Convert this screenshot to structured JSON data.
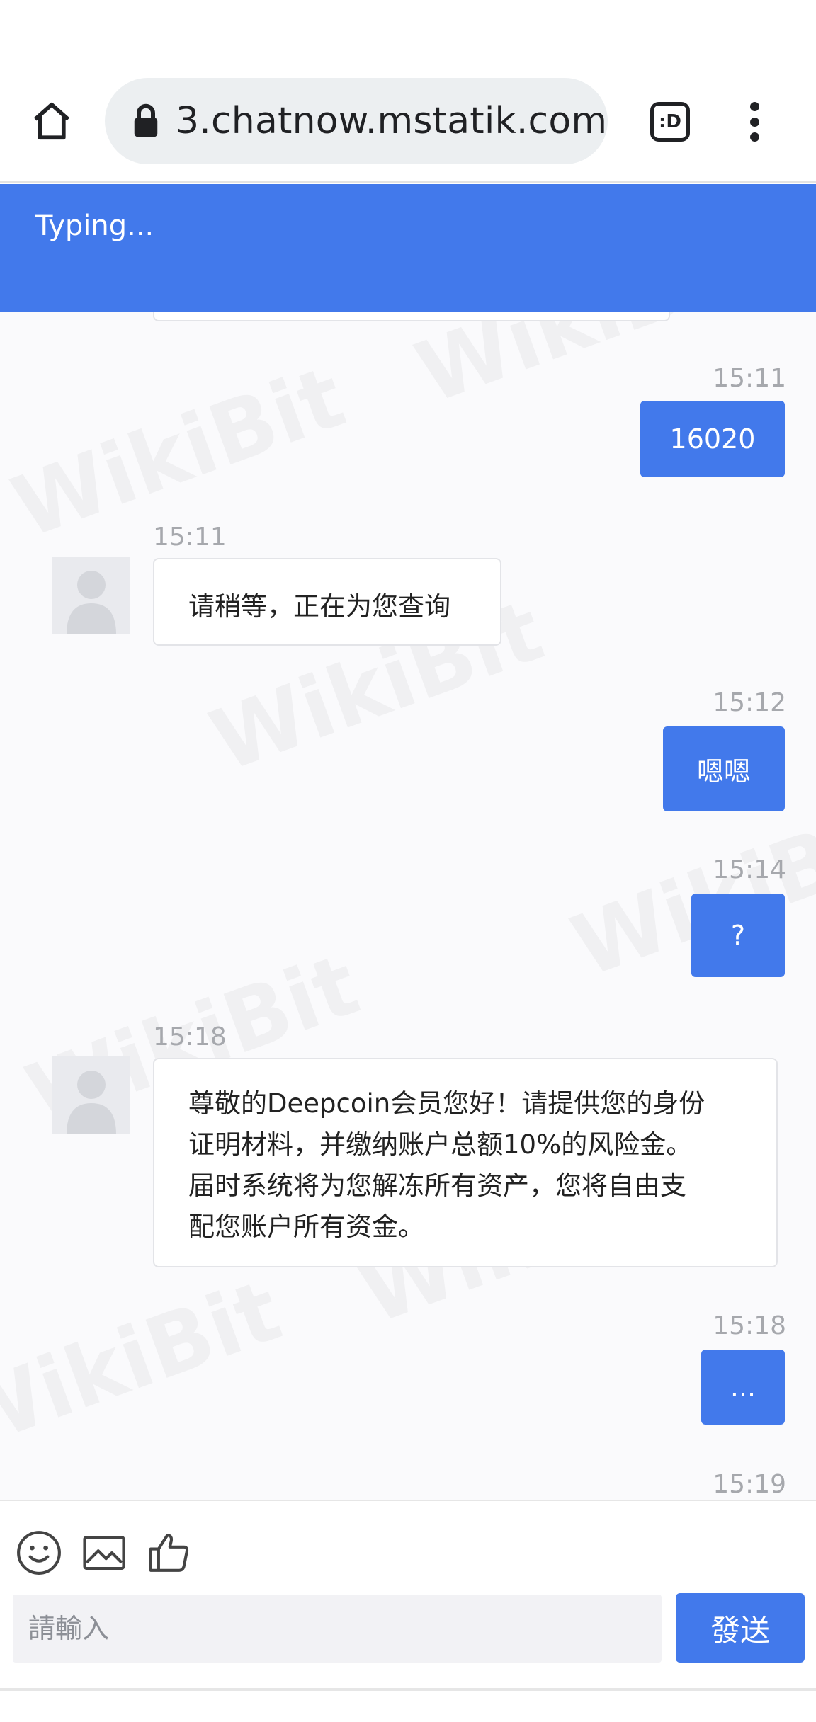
{
  "browser": {
    "url": "3.chatnow.mstatik.com",
    "tab_switcher_label": ":D"
  },
  "chat": {
    "status": "Typing...",
    "messages": [
      {
        "side": "out",
        "time": "15:11",
        "text": "16020"
      },
      {
        "side": "in",
        "time": "15:11",
        "text": "请稍等，正在为您查询"
      },
      {
        "side": "out",
        "time": "15:12",
        "text": "嗯嗯"
      },
      {
        "side": "out",
        "time": "15:14",
        "text": "?"
      },
      {
        "side": "in",
        "time": "15:18",
        "lines": [
          "尊敬的Deepcoin会员您好！请提供您的身份",
          "证明材料，并缴纳账户总额10%的风险金。",
          "届时系统将为您解冻所有资产，您将自由支",
          "配您账户所有资金。"
        ]
      },
      {
        "side": "out",
        "time": "15:18",
        "text": "..."
      },
      {
        "side": "out",
        "time": "15:19"
      }
    ]
  },
  "watermark_text": "WikiBit",
  "input": {
    "placeholder": "請輸入",
    "send_label": "發送",
    "tools": [
      "emoji-icon",
      "image-icon",
      "thumbs-up-icon"
    ]
  },
  "colors": {
    "accent": "#4279eb",
    "chat_bg": "#fafafc",
    "timestamp": "#a6a8ad"
  }
}
